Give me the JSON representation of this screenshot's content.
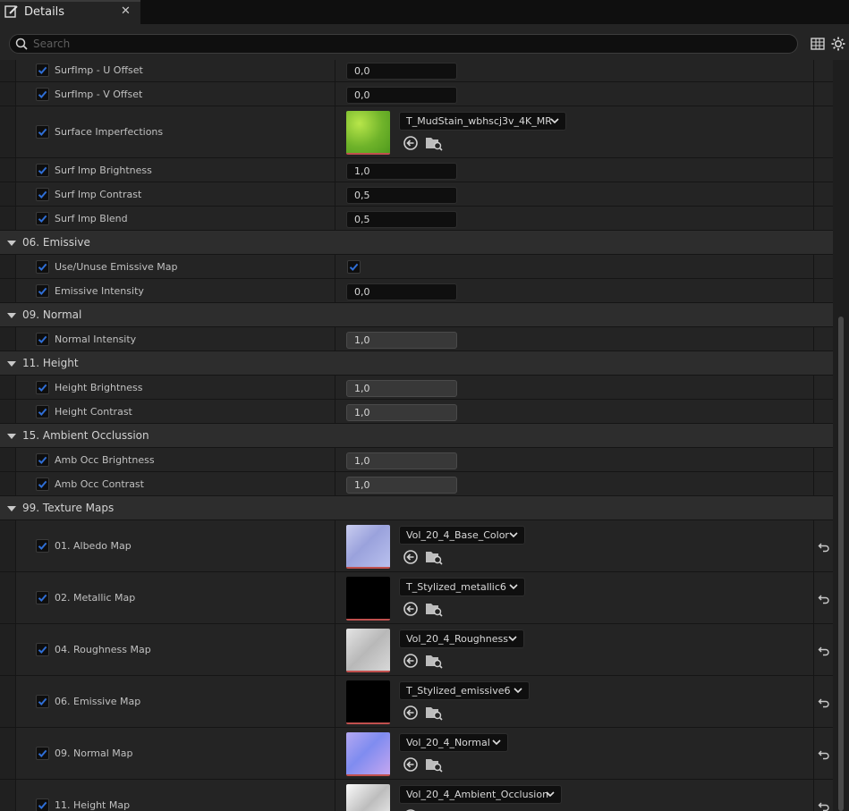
{
  "tab": {
    "title": "Details",
    "close": "✕"
  },
  "search": {
    "placeholder": "Search",
    "value": ""
  },
  "toolbar": {
    "table_icon": "table-view-icon",
    "settings_icon": "gear-icon"
  },
  "rows": [
    {
      "kind": "prop",
      "label": "SurfImp - U Offset",
      "value": "0,0"
    },
    {
      "kind": "prop",
      "label": "SurfImp - V Offset",
      "value": "0,0"
    },
    {
      "kind": "tex",
      "label": "Surface Imperfections",
      "texture": "T_MudStain_wbhscj3v_4K_MR"
    },
    {
      "kind": "prop",
      "label": "Surf Imp Brightness",
      "value": "1,0"
    },
    {
      "kind": "prop",
      "label": "Surf Imp Contrast",
      "value": "0,5"
    },
    {
      "kind": "prop",
      "label": "Surf Imp Blend",
      "value": "0,5"
    },
    {
      "kind": "cat",
      "label": "06. Emissive"
    },
    {
      "kind": "check",
      "label": "Use/Unuse Emissive Map",
      "checked": true
    },
    {
      "kind": "prop",
      "label": "Emissive Intensity",
      "value": "0,0"
    },
    {
      "kind": "cat",
      "label": "09. Normal"
    },
    {
      "kind": "prop-gray",
      "label": "Normal Intensity",
      "value": "1,0"
    },
    {
      "kind": "cat",
      "label": "11. Height"
    },
    {
      "kind": "prop-gray",
      "label": "Height Brightness",
      "value": "1,0"
    },
    {
      "kind": "prop-gray",
      "label": "Height Contrast",
      "value": "1,0"
    },
    {
      "kind": "cat",
      "label": "15. Ambient Occlussion"
    },
    {
      "kind": "prop-gray",
      "label": "Amb Occ Brightness",
      "value": "1,0"
    },
    {
      "kind": "prop-gray",
      "label": "Amb Occ Contrast",
      "value": "1,0"
    },
    {
      "kind": "cat",
      "label": "99. Texture Maps"
    },
    {
      "kind": "tex",
      "label": "01. Albedo Map",
      "texture": "Vol_20_4_Base_Color",
      "reset": true
    },
    {
      "kind": "tex",
      "label": "02. Metallic Map",
      "texture": "T_Stylized_metallic6",
      "reset": true
    },
    {
      "kind": "tex",
      "label": "04. Roughness Map",
      "texture": "Vol_20_4_Roughness",
      "reset": true
    },
    {
      "kind": "tex",
      "label": "06. Emissive Map",
      "texture": "T_Stylized_emissive6",
      "reset": true
    },
    {
      "kind": "tex",
      "label": "09. Normal Map",
      "texture": "Vol_20_4_Normal",
      "reset": true
    },
    {
      "kind": "tex",
      "label": "11. Height Map",
      "texture": "Vol_20_4_Ambient_Occlusion",
      "reset": true
    }
  ],
  "colors": {
    "accent_check": "#2f6ed6",
    "reset_stripe": "#c0504e"
  }
}
